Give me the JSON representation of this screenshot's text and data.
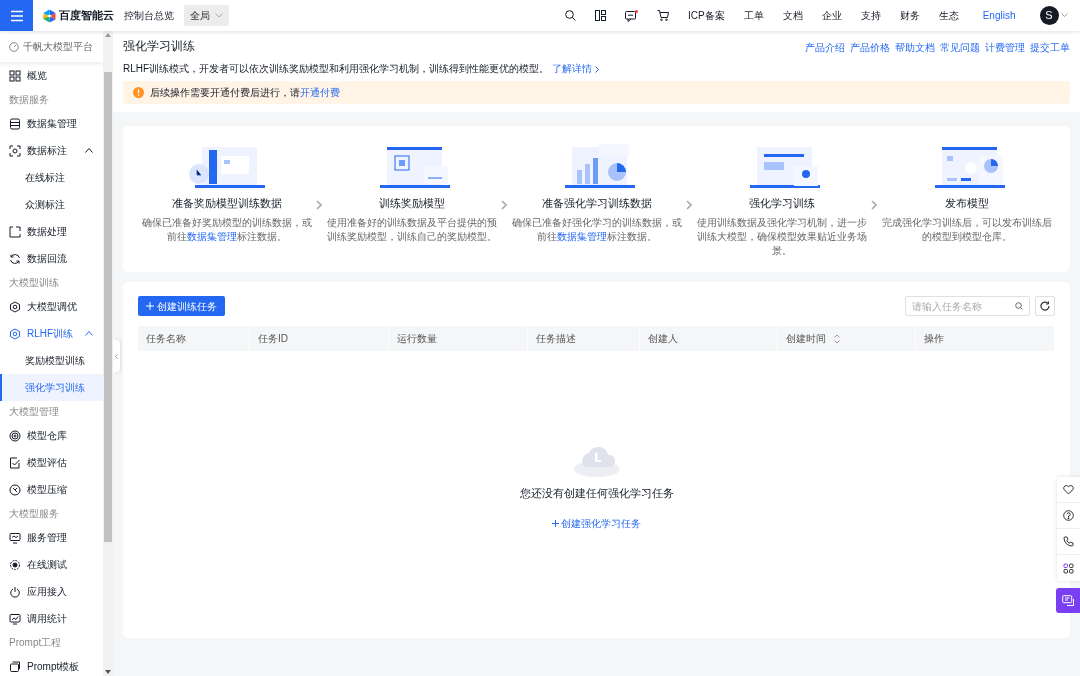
{
  "topbar": {
    "brand": "百度智能云",
    "console": "控制台总览",
    "region": "全局",
    "message_unread": true,
    "links": [
      "ICP备案",
      "工单",
      "文档",
      "企业",
      "支持",
      "财务",
      "生态"
    ],
    "language": "English",
    "avatar": "S"
  },
  "sidebar": {
    "platform": "千帆大模型平台",
    "items": [
      {
        "kind": "item",
        "label": "概览",
        "selected": false
      },
      {
        "kind": "group",
        "label": "数据服务"
      },
      {
        "kind": "item",
        "label": "数据集管理",
        "selected": false
      },
      {
        "kind": "item",
        "label": "数据标注",
        "selected": false,
        "expanded": true,
        "children": [
          {
            "label": "在线标注",
            "selected": false
          },
          {
            "label": "众测标注",
            "selected": false
          }
        ]
      },
      {
        "kind": "item",
        "label": "数据处理",
        "selected": false
      },
      {
        "kind": "item",
        "label": "数据回流",
        "selected": false
      },
      {
        "kind": "group",
        "label": "大模型训练"
      },
      {
        "kind": "item",
        "label": "大模型调优",
        "selected": false
      },
      {
        "kind": "item",
        "label": "RLHF训练",
        "selected": false,
        "expanded": true,
        "children": [
          {
            "label": "奖励模型训练",
            "selected": false
          },
          {
            "label": "强化学习训练",
            "selected": true
          }
        ]
      },
      {
        "kind": "group",
        "label": "大模型管理"
      },
      {
        "kind": "item",
        "label": "模型仓库",
        "selected": false
      },
      {
        "kind": "item",
        "label": "模型评估",
        "selected": false
      },
      {
        "kind": "item",
        "label": "模型压缩",
        "selected": false
      },
      {
        "kind": "group",
        "label": "大模型服务"
      },
      {
        "kind": "item",
        "label": "服务管理",
        "selected": false
      },
      {
        "kind": "item",
        "label": "在线测试",
        "selected": false
      },
      {
        "kind": "item",
        "label": "应用接入",
        "selected": false
      },
      {
        "kind": "item",
        "label": "调用统计",
        "selected": false
      },
      {
        "kind": "group",
        "label": "Prompt工程"
      },
      {
        "kind": "item",
        "label": "Prompt模板",
        "selected": false
      }
    ]
  },
  "page": {
    "title": "强化学习训练",
    "links": [
      "产品介绍",
      "产品价格",
      "帮助文档",
      "常见问题",
      "计费管理",
      "提交工单"
    ],
    "description": "RLHF训练模式，开发者可以依次训练奖励模型和利用强化学习机制，训练得到性能更优的模型。",
    "detail_link": "了解详情",
    "alert": {
      "text": "后续操作需要开通付费后进行，请",
      "link": "开通付费"
    }
  },
  "steps": [
    {
      "title": "准备奖励模型训练数据",
      "text": "确保已准备好奖励模型的训练数据，或前往",
      "link": "数据集管理",
      "text_after": "标注数据。"
    },
    {
      "title": "训练奖励模型",
      "text": "使用准备好的训练数据及平台提供的预训练奖励模型，训练自己的奖励模型。"
    },
    {
      "title": "准备强化学习训练数据",
      "text": "确保已准备好强化学习的训练数据，或前往",
      "link": "数据集管理",
      "text_after": "标注数据。"
    },
    {
      "title": "强化学习训练",
      "text": "使用训练数据及强化学习机制，进一步训练大模型，确保模型效果贴近业务场景。"
    },
    {
      "title": "发布模型",
      "text": "完成强化学习训练后，可以发布训练后的模型到模型仓库。"
    }
  ],
  "tasks": {
    "create_button": "创建训练任务",
    "search_placeholder": "请输入任务名称",
    "columns": [
      {
        "label": "任务名称",
        "sortable": false
      },
      {
        "label": "任务ID",
        "sortable": false
      },
      {
        "label": "运行数量",
        "sortable": false
      },
      {
        "label": "任务描述",
        "sortable": false
      },
      {
        "label": "创建人",
        "sortable": false
      },
      {
        "label": "创建时间",
        "sortable": true
      },
      {
        "label": "操作",
        "sortable": false
      }
    ],
    "empty": {
      "text": "您还没有创建任何强化学习任务",
      "link": "创建强化学习任务"
    }
  }
}
